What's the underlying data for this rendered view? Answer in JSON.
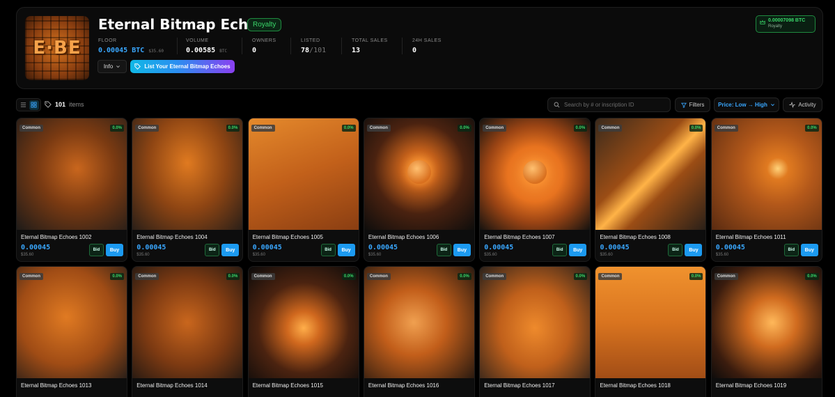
{
  "collection": {
    "logo_text": "E·BE",
    "title": "Eternal Bitmap Echoes",
    "badge": "Royalty",
    "stats": [
      {
        "label": "FLOOR",
        "value": "0.00045",
        "unit": "BTC",
        "sub": "$35.60"
      },
      {
        "label": "VOLUME",
        "value": "0.00585",
        "unit": "BTC"
      },
      {
        "label": "OWNERS",
        "value": "0"
      },
      {
        "label": "LISTED",
        "value": "78",
        "sub": "/101"
      },
      {
        "label": "TOTAL SALES",
        "value": "13"
      },
      {
        "label": "24H SALES",
        "value": "0"
      }
    ],
    "info_label": "Info",
    "list_label": "List Your Eternal Bitmap Echoes",
    "royalty_value": "0.00007098 BTC",
    "royalty_label": "Royalty"
  },
  "toolbar": {
    "items_count": "101",
    "items_word": "items",
    "search_placeholder": "Search by # or inscription ID",
    "filters_label": "Filters",
    "sort_label": "Price: Low → High",
    "activity_label": "Activity"
  },
  "colors": {
    "accent": "#39a7ff",
    "green": "#3ad86a",
    "buy": "#1c9af0"
  },
  "cards": [
    {
      "name": "Eternal Bitmap Echoes 1002",
      "rarity": "Common",
      "pct": "0.0%",
      "price": "0.00045",
      "usd": "$35.60",
      "bid": "Bid",
      "buy": "Buy",
      "art": "a1"
    },
    {
      "name": "Eternal Bitmap Echoes 1004",
      "rarity": "Common",
      "pct": "0.0%",
      "price": "0.00045",
      "usd": "$35.60",
      "bid": "Bid",
      "buy": "Buy",
      "art": "a2"
    },
    {
      "name": "Eternal Bitmap Echoes 1005",
      "rarity": "Common",
      "pct": "0.0%",
      "price": "0.00045",
      "usd": "$35.60",
      "bid": "Bid",
      "buy": "Buy",
      "art": "a3"
    },
    {
      "name": "Eternal Bitmap Echoes 1006",
      "rarity": "Common",
      "pct": "0.0%",
      "price": "0.00045",
      "usd": "$35.60",
      "bid": "Bid",
      "buy": "Buy",
      "art": "a4"
    },
    {
      "name": "Eternal Bitmap Echoes 1007",
      "rarity": "Common",
      "pct": "0.0%",
      "price": "0.00045",
      "usd": "$35.60",
      "bid": "Bid",
      "buy": "Buy",
      "art": "a5"
    },
    {
      "name": "Eternal Bitmap Echoes 1008",
      "rarity": "Common",
      "pct": "0.0%",
      "price": "0.00045",
      "usd": "$35.60",
      "bid": "Bid",
      "buy": "Buy",
      "art": "a6"
    },
    {
      "name": "Eternal Bitmap Echoes 1011",
      "rarity": "Common",
      "pct": "0.0%",
      "price": "0.00045",
      "usd": "$35.60",
      "bid": "Bid",
      "buy": "Buy",
      "art": "a7"
    },
    {
      "name": "Eternal Bitmap Echoes 1013",
      "rarity": "Common",
      "pct": "0.0%",
      "art": "a8"
    },
    {
      "name": "Eternal Bitmap Echoes 1014",
      "rarity": "Common",
      "pct": "0.0%",
      "art": "a9"
    },
    {
      "name": "Eternal Bitmap Echoes 1015",
      "rarity": "Common",
      "pct": "0.0%",
      "art": "a10"
    },
    {
      "name": "Eternal Bitmap Echoes 1016",
      "rarity": "Common",
      "pct": "0.0%",
      "art": "a11"
    },
    {
      "name": "Eternal Bitmap Echoes 1017",
      "rarity": "Common",
      "pct": "0.0%",
      "art": "a12"
    },
    {
      "name": "Eternal Bitmap Echoes 1018",
      "rarity": "Common",
      "pct": "0.0%",
      "art": "a13"
    },
    {
      "name": "Eternal Bitmap Echoes 1019",
      "rarity": "Common",
      "pct": "0.0%",
      "art": "a14"
    }
  ]
}
